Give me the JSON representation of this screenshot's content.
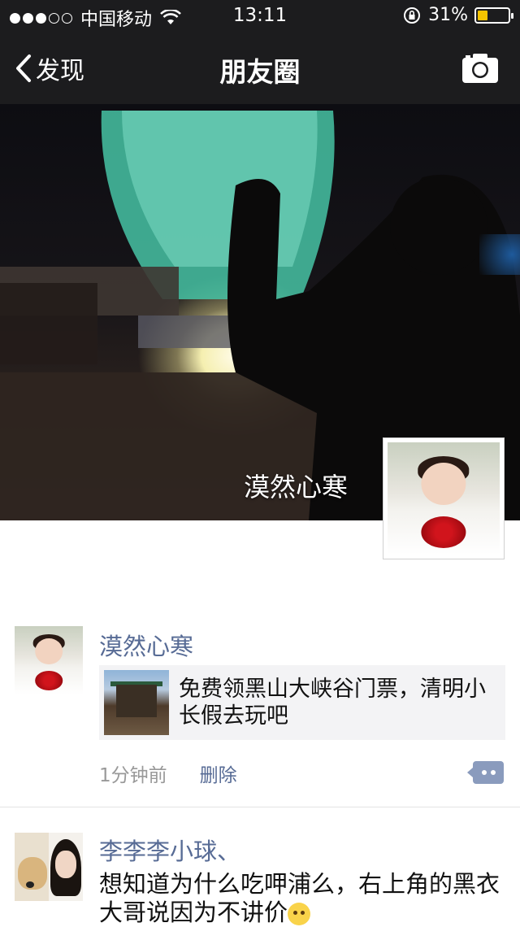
{
  "status_bar": {
    "carrier": "中国移动",
    "time": "13:11",
    "battery_percent": "31%",
    "battery_level": 0.31,
    "signal_strength": 3,
    "signal_max": 5,
    "battery_color": "#f5c400"
  },
  "nav": {
    "back_label": "发现",
    "title": "朋友圈",
    "camera_icon": "camera-icon"
  },
  "cover": {
    "user_name": "漠然心寒"
  },
  "posts": [
    {
      "author": "漠然心寒",
      "share_text": "免费领黑山大峡谷门票，清明小长假去玩吧",
      "time": "1分钟前",
      "delete_label": "删除"
    },
    {
      "author": "李李李小球、",
      "text": "想知道为什么吃呷浦么，右上角的黑衣大哥说因为不讲价"
    }
  ],
  "colors": {
    "link": "#576b95",
    "nav_bg": "#1c1c1e",
    "meta": "#999999"
  }
}
